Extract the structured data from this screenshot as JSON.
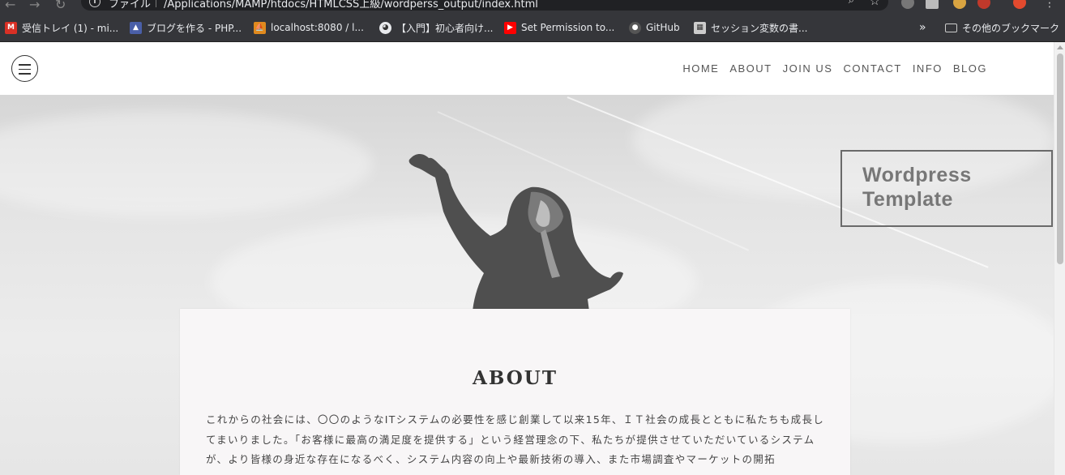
{
  "browser": {
    "address_label": "ファイル",
    "url": "/Applications/MAMP/htdocs/HTMLCSS上級/wordperss_output/index.html",
    "zoom_icon": "zoom-icon",
    "bookmarks": [
      {
        "label": "受信トレイ (1) - mi...",
        "icon": "gmail-icon",
        "color": "#d93025",
        "glyph": "M"
      },
      {
        "label": "ブログを作る - PHP...",
        "icon": "php-icon",
        "color": "#4a5fa8",
        "glyph": "▲"
      },
      {
        "label": "localhost:8080 / l...",
        "icon": "phpmyadmin-icon",
        "color": "#e08a1e",
        "glyph": "⛵"
      },
      {
        "label": "【入門】初心者向け...",
        "icon": "globe-icon",
        "color": "#e8eaed",
        "glyph": "◕"
      },
      {
        "label": "Set Permission to...",
        "icon": "youtube-icon",
        "color": "#ff0000",
        "glyph": "▶"
      },
      {
        "label": "GitHub",
        "icon": "github-icon",
        "color": "#555555",
        "glyph": "●"
      },
      {
        "label": "セッション変数の書...",
        "icon": "grid-icon",
        "color": "#cccccc",
        "glyph": "▦"
      }
    ],
    "more_bookmarks": "»",
    "other_bookmarks": "その他のブックマーク"
  },
  "site": {
    "nav": [
      "HOME",
      "ABOUT",
      "JOIN US",
      "CONTACT",
      "INFO",
      "BLOG"
    ],
    "hero_title_line1": "Wordpress",
    "hero_title_line2": "Template",
    "about_title": "ABOUT",
    "about_text": "これからの社会には、〇〇のようなITシステムの必要性を感じ創業して以来15年、ＩＴ社会の成長とともに私たちも成長してまいりました。「お客様に最高の満足度を提供する」という経営理念の下、私たちが提供させていただいているシステムが、より皆様の身近な存在になるべく、システム内容の向上や最新技術の導入、また市場調査やマーケットの開拓"
  }
}
